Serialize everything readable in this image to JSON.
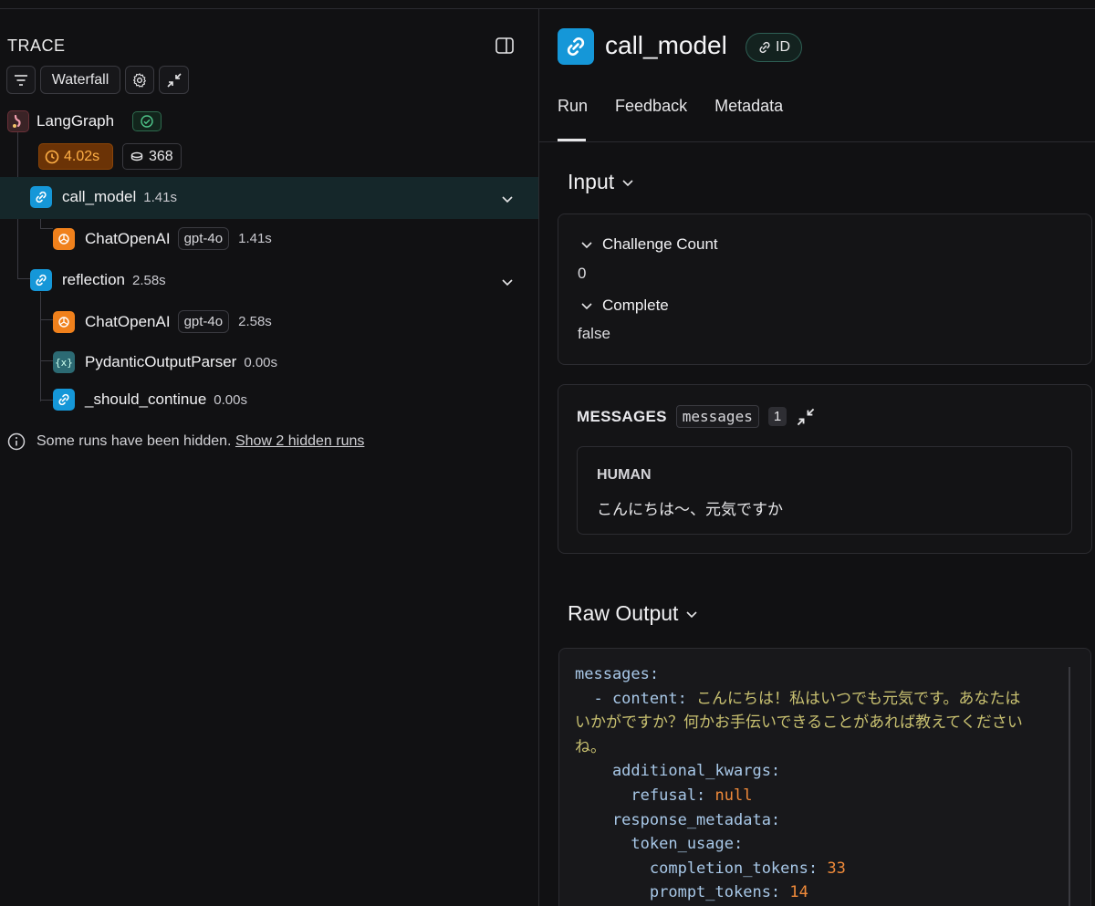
{
  "left": {
    "title": "TRACE",
    "view_button": "Waterfall",
    "root": {
      "name": "LangGraph",
      "duration": "4.02s",
      "tokens": "368"
    },
    "runs": [
      {
        "name": "call_model",
        "time": "1.41s"
      },
      {
        "name": "ChatOpenAI",
        "model": "gpt-4o",
        "time": "1.41s"
      },
      {
        "name": "reflection",
        "time": "2.58s"
      },
      {
        "name": "ChatOpenAI",
        "model": "gpt-4o",
        "time": "2.58s"
      },
      {
        "name": "PydanticOutputParser",
        "time": "0.00s"
      },
      {
        "name": "_should_continue",
        "time": "0.00s"
      }
    ],
    "parser_icon_text": "{x}",
    "hidden_note": "Some runs have been hidden.",
    "hidden_link": "Show 2 hidden runs"
  },
  "right": {
    "title": "call_model",
    "id_label": "ID",
    "tabs": [
      "Run",
      "Feedback",
      "Metadata"
    ],
    "input_title": "Input",
    "fields": [
      {
        "label": "Challenge Count",
        "value": "0"
      },
      {
        "label": "Complete",
        "value": "false"
      }
    ],
    "messages": {
      "label": "MESSAGES",
      "key": "messages",
      "count": "1",
      "role": "HUMAN",
      "text": "こんにちは〜、元気ですか"
    },
    "raw_output_title": "Raw Output",
    "raw": {
      "l1": "messages:",
      "l2_key": "  - content: ",
      "l2_val": "こんにちは！私はいつでも元気です。あなたは",
      "l3_val": "いかがですか？何かお手伝いできることがあれば教えてください",
      "l4_val": "ね。",
      "l5": "    additional_kwargs:",
      "l6_key": "      refusal: ",
      "l6_val": "null",
      "l7": "    response_metadata:",
      "l8": "      token_usage:",
      "l9_key": "        completion_tokens: ",
      "l9_val": "33",
      "l10_key": "        prompt_tokens: ",
      "l10_val": "14"
    }
  },
  "colors": {
    "accent_blue": "#1597d8",
    "accent_orange": "#f0811c",
    "duration_bg": "#6b3306",
    "selected_row": "#15272a"
  }
}
